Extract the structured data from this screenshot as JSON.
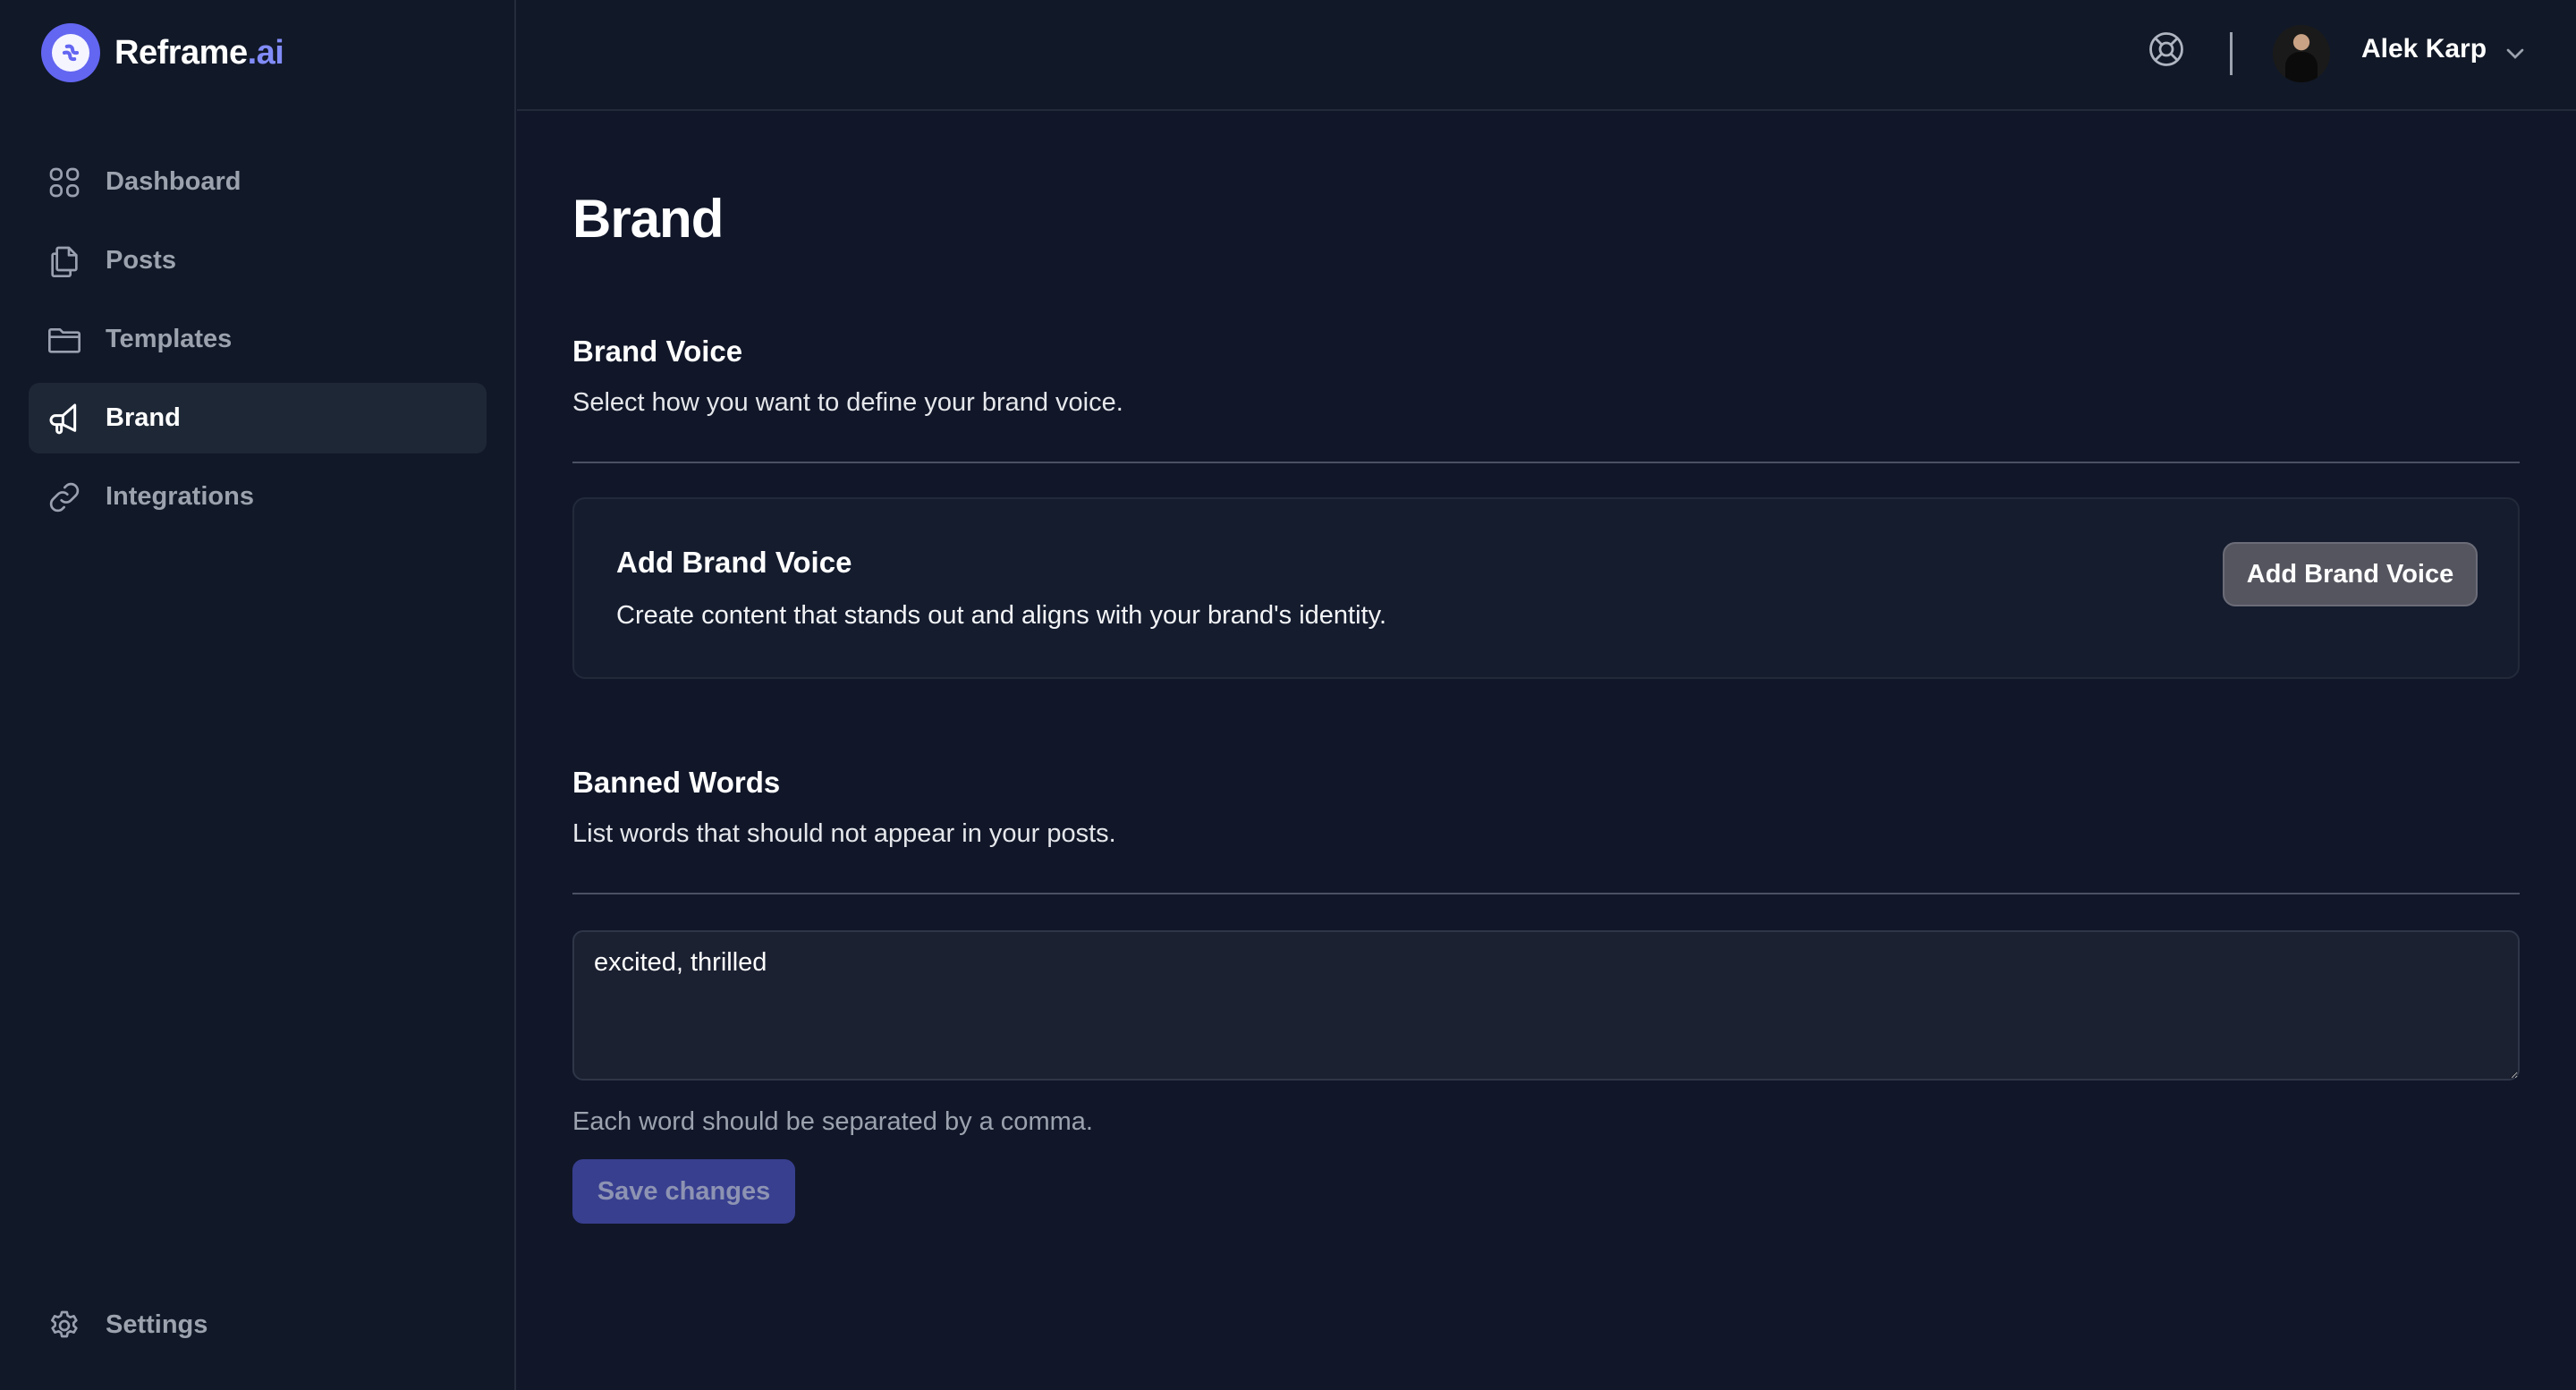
{
  "app": {
    "logo_text": "Reframe",
    "logo_suffix": ".ai",
    "accent_color": "#6366f1"
  },
  "sidebar": {
    "items": [
      {
        "label": "Dashboard",
        "icon": "grid-icon",
        "active": false
      },
      {
        "label": "Posts",
        "icon": "documents-icon",
        "active": false
      },
      {
        "label": "Templates",
        "icon": "folder-icon",
        "active": false
      },
      {
        "label": "Brand",
        "icon": "megaphone-icon",
        "active": true
      },
      {
        "label": "Integrations",
        "icon": "link-icon",
        "active": false
      }
    ],
    "settings_label": "Settings"
  },
  "header": {
    "help_icon": "lifebuoy-icon",
    "user_name": "Alek Karp"
  },
  "main": {
    "page_title": "Brand",
    "brand_voice": {
      "title": "Brand Voice",
      "description": "Select how you want to define your brand voice.",
      "card": {
        "title": "Add Brand Voice",
        "description": "Create content that stands out and aligns with your brand's identity.",
        "button_label": "Add Brand Voice"
      }
    },
    "banned_words": {
      "title": "Banned Words",
      "description": "List words that should not appear in your posts.",
      "value": "excited, thrilled",
      "help_text": "Each word should be separated by a comma.",
      "save_label": "Save changes"
    }
  }
}
